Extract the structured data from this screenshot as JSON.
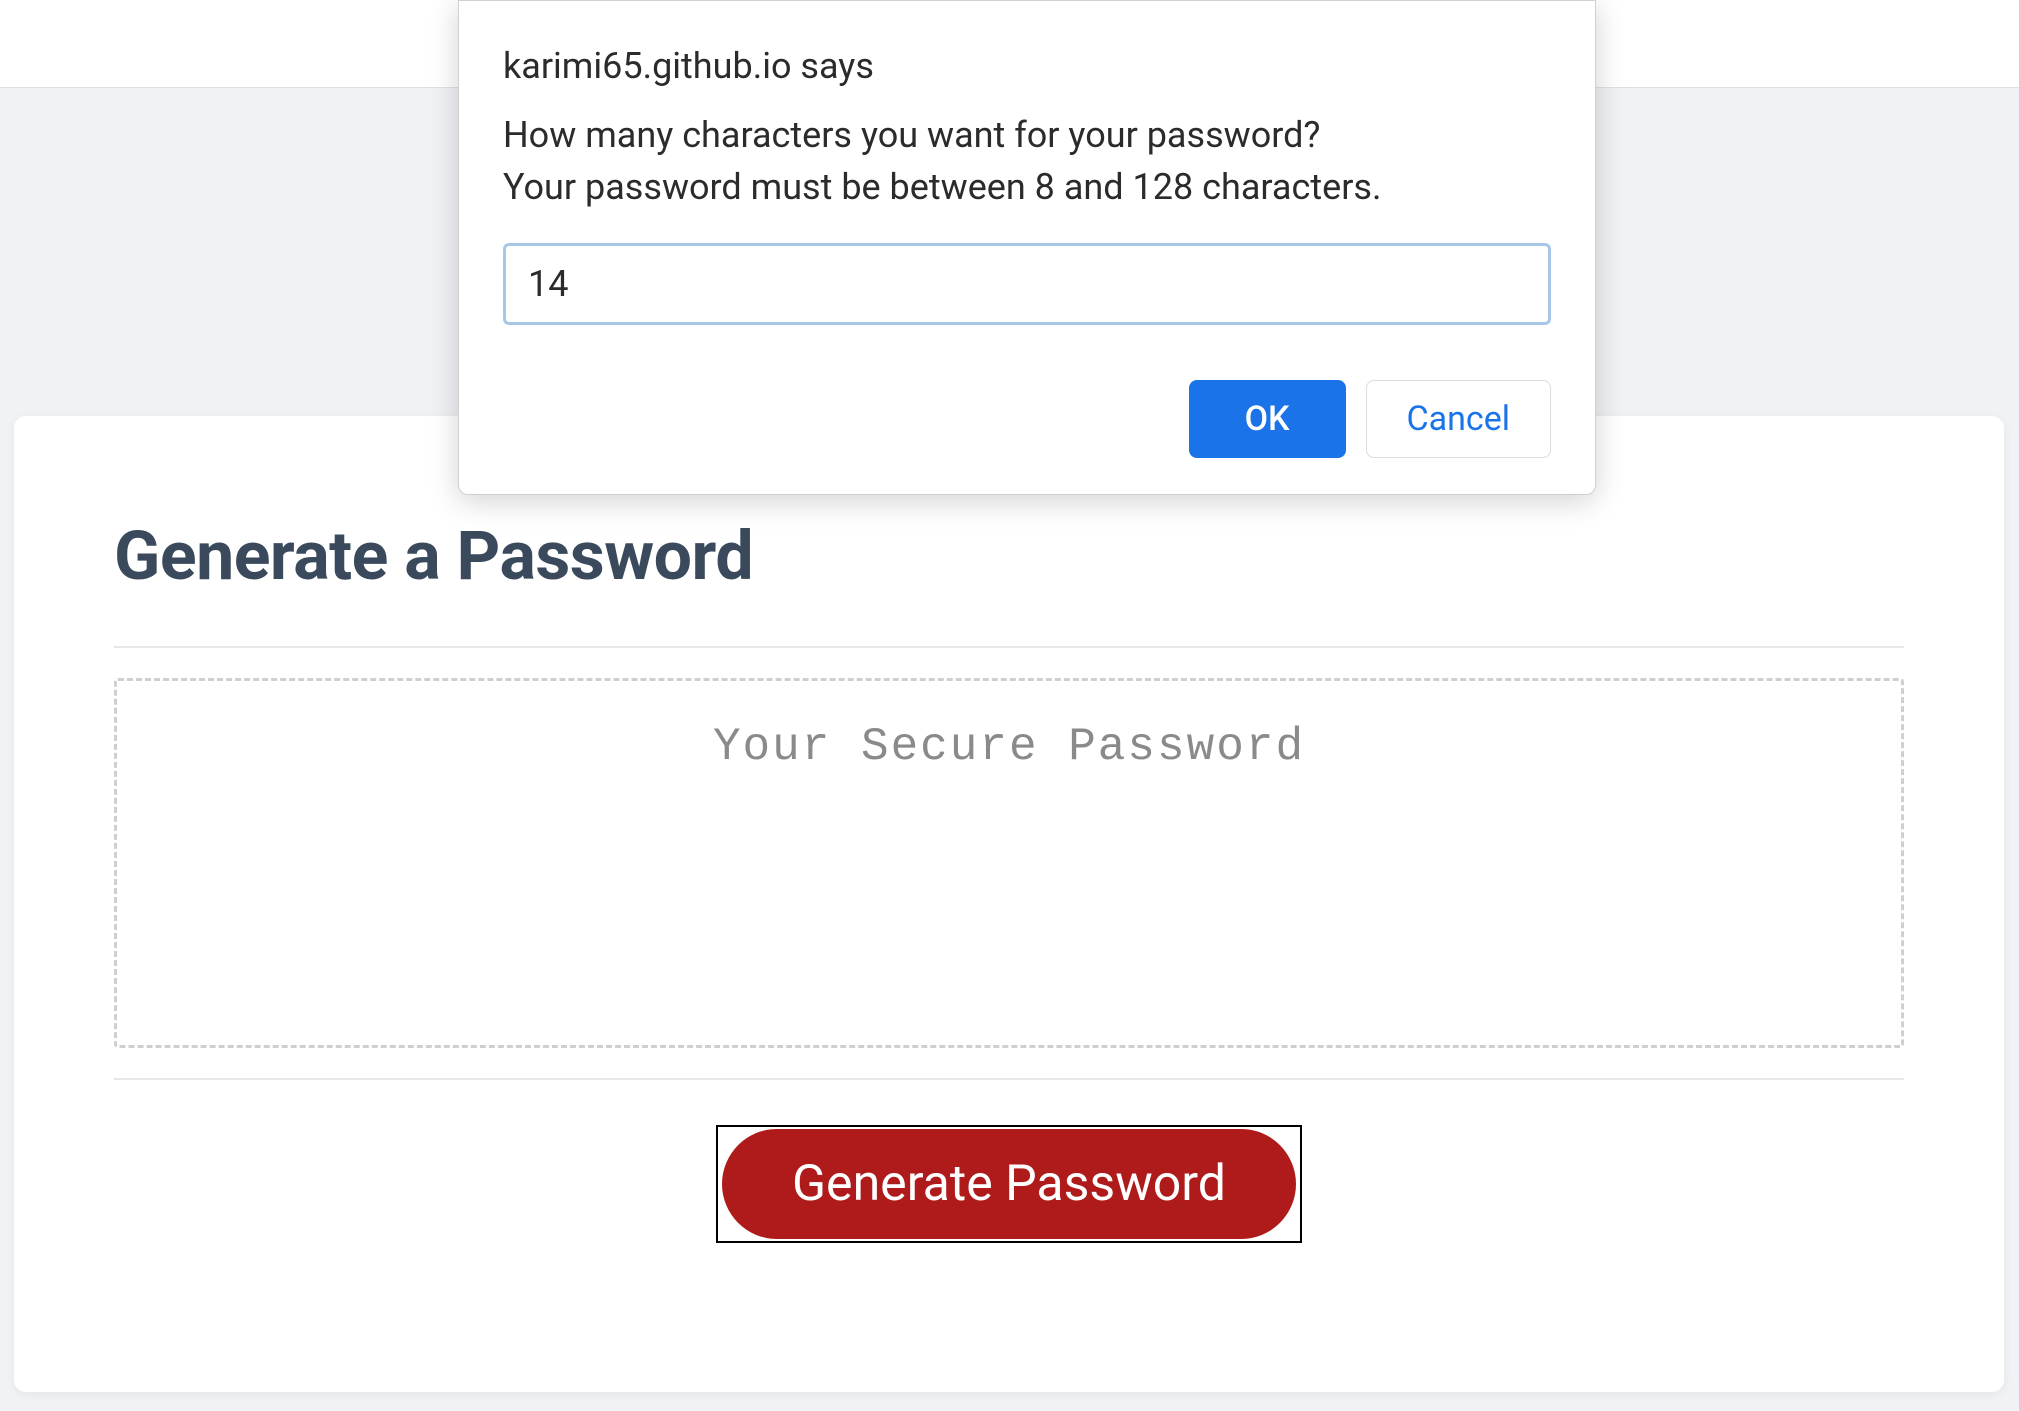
{
  "dialog": {
    "origin": "karimi65.github.io says",
    "message": "How many characters you want for your password?\n Your password must be between 8 and 128 characters.",
    "input_value": "14",
    "ok_label": "OK",
    "cancel_label": "Cancel"
  },
  "page": {
    "title": "Generate a Password",
    "password_placeholder": "Your Secure Password",
    "generate_button_label": "Generate Password"
  },
  "colors": {
    "primary_blue": "#1a73e8",
    "danger_red": "#af1b1b",
    "heading_text": "#3a4a5c",
    "muted_text": "#8a8a8a"
  }
}
